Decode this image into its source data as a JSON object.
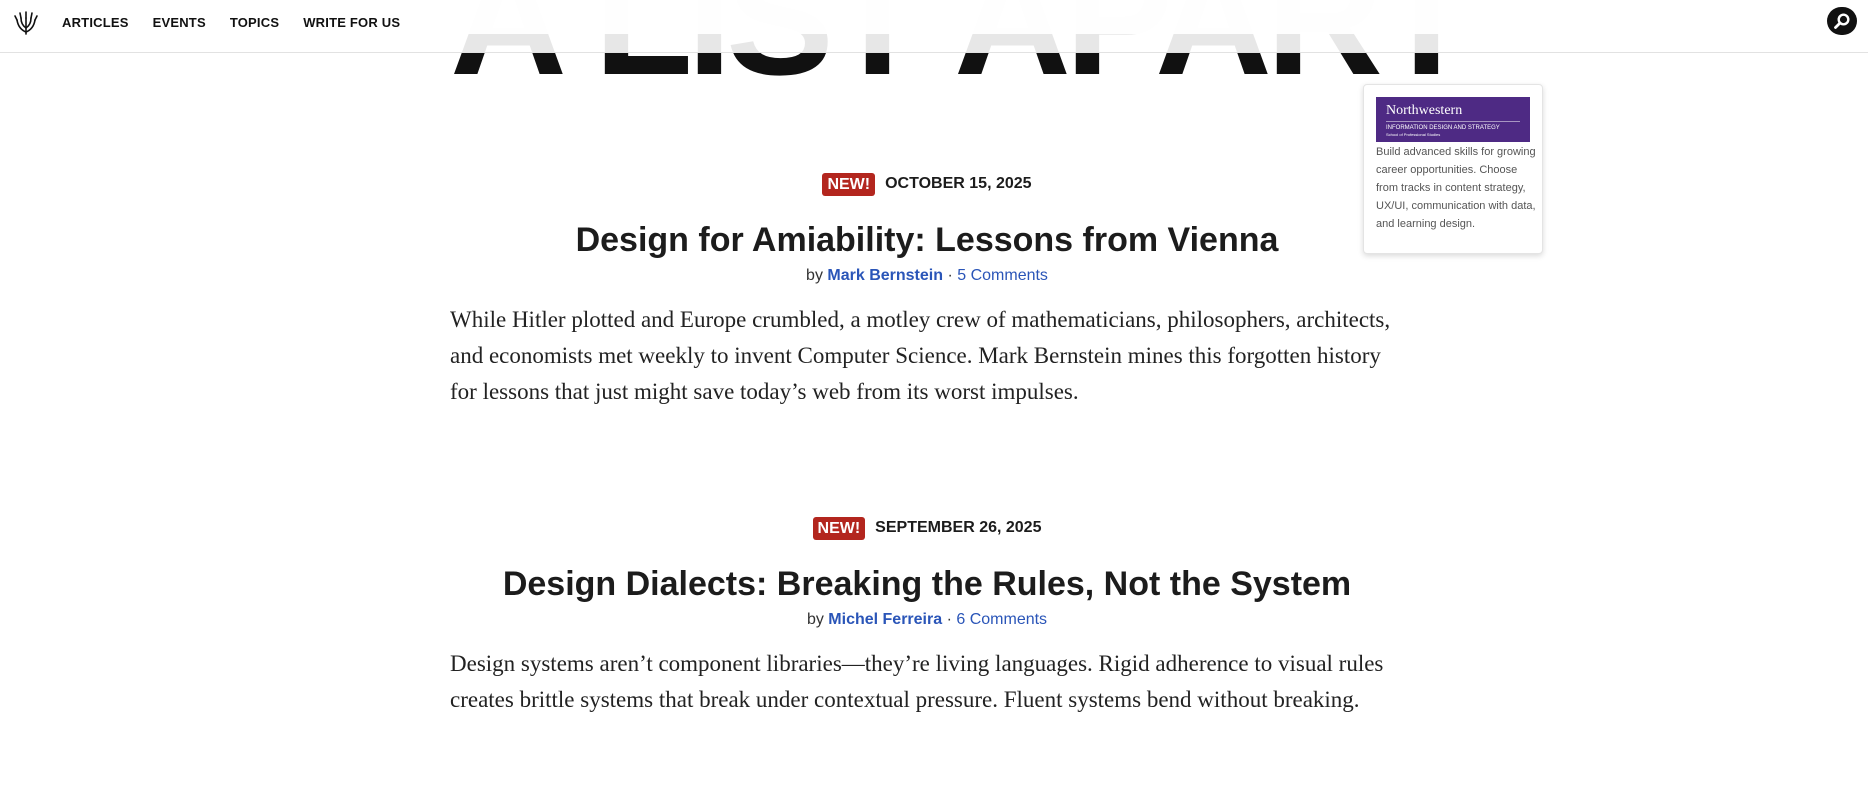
{
  "site": {
    "masthead": "A LIST APART"
  },
  "nav": {
    "logo_icon": "ala-emblem-icon",
    "links": [
      "ARTICLES",
      "EVENTS",
      "TOPICS",
      "WRITE FOR US"
    ],
    "search_icon": "search-icon"
  },
  "ad": {
    "brand": "Northwestern",
    "program": "INFORMATION DESIGN AND STRATEGY",
    "school": "School of Professional Studies",
    "copy": "Build advanced skills for growing career opportunities. Choose from tracks in content strategy, UX/UI, communication with data, and learning design.",
    "brand_color": "#4e2a84"
  },
  "articles": [
    {
      "badge": "NEW!",
      "date": "OCTOBER 15, 2025",
      "title": "Design for Amiability: Lessons from Vienna",
      "by": "by",
      "author": "Mark Bernstein",
      "separator": "·",
      "comments": "5 Comments",
      "excerpt": "While Hitler plotted and Europe crumbled, a motley crew of mathematicians, philosophers, architects, and economists met weekly to invent Computer Science. Mark Bernstein mines this forgotten history for lessons that just might save today’s web from its worst impulses."
    },
    {
      "badge": "NEW!",
      "date": "SEPTEMBER 26, 2025",
      "title": "Design Dialects: Breaking the Rules, Not the System",
      "by": "by",
      "author": "Michel Ferreira",
      "separator": "·",
      "comments": "6 Comments",
      "excerpt": "Design systems aren’t component libraries—they’re living languages. Rigid adherence to visual rules creates brittle systems that break under contextual pressure. Fluent systems bend without breaking."
    }
  ],
  "colors": {
    "badge": "#b3261e",
    "link": "#2a55b8"
  }
}
